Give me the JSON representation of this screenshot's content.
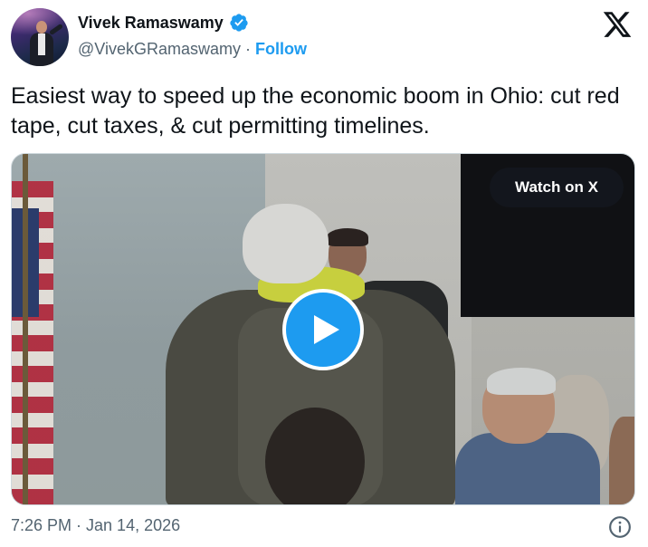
{
  "author": {
    "display_name": "Vivek Ramaswamy",
    "handle": "@VivekGRamaswamy",
    "separator": "·",
    "follow_label": "Follow",
    "verified_icon": "verified-badge-icon",
    "avatar_icon": "profile-avatar"
  },
  "brand": {
    "logo_icon": "x-logo-icon",
    "accent_color": "#1d9bf0"
  },
  "tweet": {
    "text": "Easiest way to speed up the economic boom in Ohio: cut red tape, cut taxes, & cut permitting timelines."
  },
  "media": {
    "watch_label": "Watch on X",
    "play_icon": "play-icon"
  },
  "footer": {
    "timestamp": "7:26 PM · Jan 14, 2026",
    "info_icon": "info-icon"
  }
}
